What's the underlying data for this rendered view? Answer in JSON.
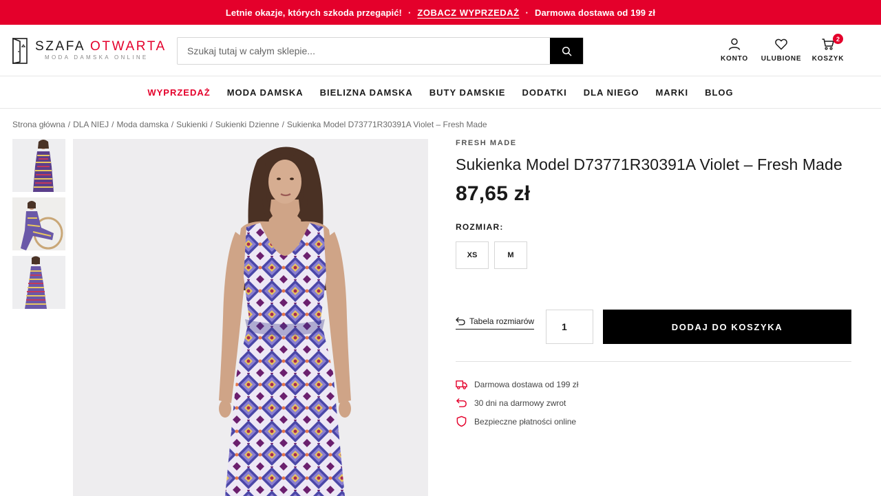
{
  "promo": {
    "text": "Letnie okazje, których szkoda przegapić!",
    "cta": "ZOBACZ WYPRZEDAŻ",
    "shipping": "Darmowa dostawa od 199 zł",
    "separator": "·",
    "bg_color": "#e4002b"
  },
  "header": {
    "logo_part1": "SZAFA",
    "logo_part2": "OTWARTA",
    "logo_sub": "MODA DAMSKA ONLINE",
    "search_placeholder": "Szukaj tutaj w całym sklepie...",
    "account_label": "KONTO",
    "wishlist_label": "ULUBIONE",
    "cart_label": "KOSZYK",
    "cart_count": "2"
  },
  "nav": {
    "items": [
      "WYPRZEDAŻ",
      "MODA DAMSKA",
      "BIELIZNA DAMSKA",
      "BUTY DAMSKIE",
      "DODATKI",
      "DLA NIEGO",
      "MARKI",
      "BLOG"
    ]
  },
  "breadcrumb": {
    "items": [
      "Strona główna",
      "DLA NIEJ",
      "Moda damska",
      "Sukienki",
      "Sukienki Dzienne",
      "Sukienka Model D73771R30391A Violet – Fresh Made"
    ],
    "separator": "/"
  },
  "product": {
    "brand": "FRESH MADE",
    "title": "Sukienka Model D73771R30391A Violet – Fresh Made",
    "price": "87,65 zł",
    "size_label": "ROZMIAR:",
    "sizes": [
      "XS",
      "M"
    ],
    "size_table_label": "Tabela rozmiarów",
    "quantity": "1",
    "add_to_cart": "DODAJ DO KOSZYKA",
    "features": [
      {
        "icon": "truck-icon",
        "text": "Darmowa dostawa od 199 zł"
      },
      {
        "icon": "return-icon",
        "text": "30 dni na darmowy zwrot"
      },
      {
        "icon": "shield-icon",
        "text": "Bezpieczne płatności online"
      }
    ]
  },
  "colors": {
    "accent": "#e4002b",
    "button": "#000000",
    "text": "#1a1a1a"
  }
}
